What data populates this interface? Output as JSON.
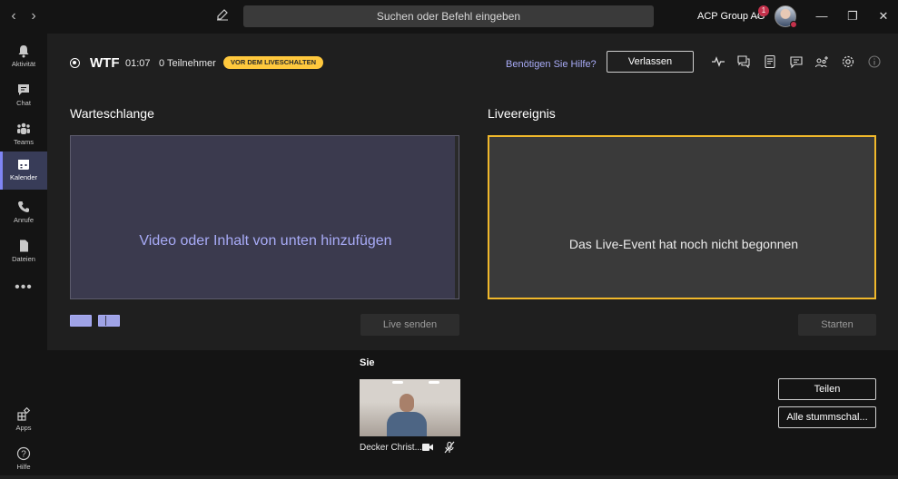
{
  "titlebar": {
    "search_placeholder": "Suchen oder Befehl eingeben",
    "org_name": "ACP Group AG",
    "notification_count": "1",
    "back_icon": "chevron-left-icon",
    "forward_icon": "chevron-right-icon"
  },
  "rail": {
    "items": [
      {
        "label": "Aktivität",
        "icon": "bell-icon"
      },
      {
        "label": "Chat",
        "icon": "chat-icon"
      },
      {
        "label": "Teams",
        "icon": "teams-icon"
      },
      {
        "label": "Kalender",
        "icon": "calendar-icon",
        "active": true
      },
      {
        "label": "Anrufe",
        "icon": "phone-icon"
      },
      {
        "label": "Dateien",
        "icon": "file-icon"
      },
      {
        "label": "Apps",
        "icon": "apps-icon"
      },
      {
        "label": "Hilfe",
        "icon": "help-icon"
      }
    ]
  },
  "event": {
    "title": "WTF",
    "time": "01:07",
    "participants": "0 Teilnehmer",
    "status_badge": "VOR DEM LIVESCHALTEN",
    "help_link": "Benötigen Sie Hilfe?",
    "leave_label": "Verlassen"
  },
  "queue": {
    "title": "Warteschlange",
    "placeholder": "Video oder Inhalt von unten hinzufügen",
    "send_live_label": "Live senden"
  },
  "live": {
    "title": "Liveereignis",
    "message": "Das Live-Event hat noch nicht begonnen",
    "start_label": "Starten"
  },
  "presenters": {
    "heading": "Sie",
    "name": "Decker Christ...",
    "share_label": "Teilen",
    "mute_all_label": "Alle stummschal..."
  },
  "colors": {
    "accent": "#a8abf7",
    "live_border": "#f0b82b",
    "badge": "#ffc83d",
    "rail_active": "#383c58"
  }
}
